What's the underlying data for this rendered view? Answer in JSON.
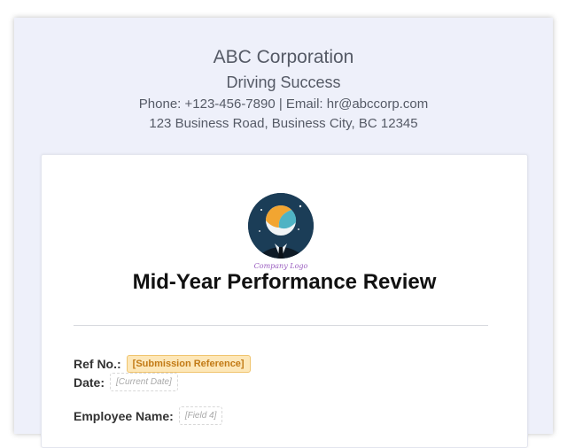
{
  "company": {
    "name": "ABC Corporation",
    "tagline": "Driving Success",
    "contact": "Phone: +123-456-7890 | Email: hr@abccorp.com",
    "address": "123 Business Road, Business City, BC 12345"
  },
  "logo": {
    "caption": "Company Logo",
    "icon": "businessman-logo-icon"
  },
  "document": {
    "title": "Mid-Year Performance Review",
    "fields": {
      "ref_label": "Ref No.:",
      "ref_value": "[Submission Reference]",
      "date_label": "Date:",
      "date_value": "[Current Date]",
      "employee_label": "Employee Name:",
      "employee_value": "[Field 4]"
    }
  },
  "colors": {
    "page_background": "#eef0fa",
    "badge_background": "#fde7b8",
    "badge_text": "#c27a15"
  }
}
